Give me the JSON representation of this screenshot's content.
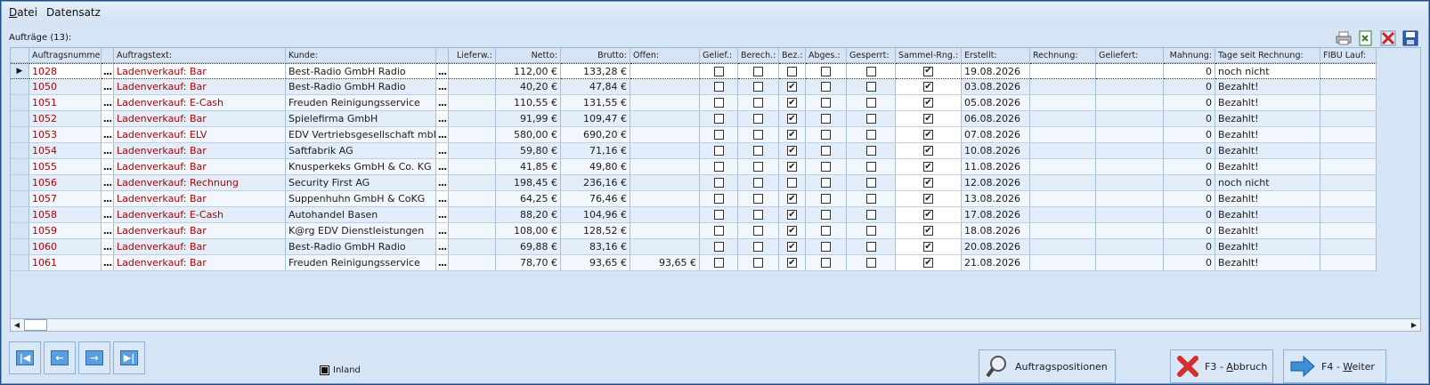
{
  "menu": {
    "datei": "Datei",
    "datei_rest": "atei",
    "datensatz": "Datensatz"
  },
  "grid": {
    "title": "Aufträge (13):",
    "columns": [
      "Auftragsnummer:",
      "",
      "Auftragstext:",
      "Kunde:",
      "",
      "Lieferw.:",
      "Netto:",
      "Brutto:",
      "Offen:",
      "Gelief.:",
      "Berech.:",
      "Bez.:",
      "Abges.:",
      "Gesperrt:",
      "Sammel-Rng.:",
      "Erstellt:",
      "Rechnung:",
      "Geliefert:",
      "Mahnung:",
      "Tage seit Rechnung:",
      "FIBU Lauf:"
    ],
    "rows": [
      {
        "nr": "1028",
        "text": "Ladenverkauf: Bar",
        "kunde": "Best-Radio GmbH Radio",
        "netto": "112,00 €",
        "brutto": "133,28 €",
        "offen": "",
        "bez": false,
        "sammel": true,
        "erstellt": "19.08.2026",
        "mahnung": "0",
        "tage": "noch nicht"
      },
      {
        "nr": "1050",
        "text": "Ladenverkauf: Bar",
        "kunde": "Best-Radio GmbH Radio",
        "netto": "40,20 €",
        "brutto": "47,84 €",
        "offen": "",
        "bez": true,
        "sammel": true,
        "erstellt": "03.08.2026",
        "mahnung": "0",
        "tage": "Bezahlt!"
      },
      {
        "nr": "1051",
        "text": "Ladenverkauf: E-Cash",
        "kunde": "Freuden Reinigungsservice",
        "netto": "110,55 €",
        "brutto": "131,55 €",
        "offen": "",
        "bez": true,
        "sammel": true,
        "erstellt": "05.08.2026",
        "mahnung": "0",
        "tage": "Bezahlt!"
      },
      {
        "nr": "1052",
        "text": "Ladenverkauf: Bar",
        "kunde": "Spielefirma GmbH",
        "netto": "91,99 €",
        "brutto": "109,47 €",
        "offen": "",
        "bez": true,
        "sammel": true,
        "erstellt": "06.08.2026",
        "mahnung": "0",
        "tage": "Bezahlt!"
      },
      {
        "nr": "1053",
        "text": "Ladenverkauf: ELV",
        "kunde": "EDV Vertriebsgesellschaft mbH",
        "netto": "580,00 €",
        "brutto": "690,20 €",
        "offen": "",
        "bez": true,
        "sammel": true,
        "erstellt": "07.08.2026",
        "mahnung": "0",
        "tage": "Bezahlt!"
      },
      {
        "nr": "1054",
        "text": "Ladenverkauf: Bar",
        "kunde": "Saftfabrik AG",
        "netto": "59,80 €",
        "brutto": "71,16 €",
        "offen": "",
        "bez": true,
        "sammel": true,
        "erstellt": "10.08.2026",
        "mahnung": "0",
        "tage": "Bezahlt!"
      },
      {
        "nr": "1055",
        "text": "Ladenverkauf: Bar",
        "kunde": "Knusperkeks GmbH & Co. KG",
        "netto": "41,85 €",
        "brutto": "49,80 €",
        "offen": "",
        "bez": true,
        "sammel": true,
        "erstellt": "11.08.2026",
        "mahnung": "0",
        "tage": "Bezahlt!"
      },
      {
        "nr": "1056",
        "text": "Ladenverkauf: Rechnung",
        "kunde": "Security First AG",
        "netto": "198,45 €",
        "brutto": "236,16 €",
        "offen": "",
        "bez": false,
        "sammel": true,
        "erstellt": "12.08.2026",
        "mahnung": "0",
        "tage": "noch nicht"
      },
      {
        "nr": "1057",
        "text": "Ladenverkauf: Bar",
        "kunde": "Suppenhuhn GmbH & CoKG",
        "netto": "64,25 €",
        "brutto": "76,46 €",
        "offen": "",
        "bez": true,
        "sammel": true,
        "erstellt": "13.08.2026",
        "mahnung": "0",
        "tage": "Bezahlt!"
      },
      {
        "nr": "1058",
        "text": "Ladenverkauf: E-Cash",
        "kunde": "Autohandel Basen",
        "netto": "88,20 €",
        "brutto": "104,96 €",
        "offen": "",
        "bez": true,
        "sammel": true,
        "erstellt": "17.08.2026",
        "mahnung": "0",
        "tage": "Bezahlt!"
      },
      {
        "nr": "1059",
        "text": "Ladenverkauf: Bar",
        "kunde": "K@rg EDV Dienstleistungen",
        "netto": "108,00 €",
        "brutto": "128,52 €",
        "offen": "",
        "bez": true,
        "sammel": true,
        "erstellt": "18.08.2026",
        "mahnung": "0",
        "tage": "Bezahlt!"
      },
      {
        "nr": "1060",
        "text": "Ladenverkauf: Bar",
        "kunde": "Best-Radio GmbH Radio",
        "netto": "69,88 €",
        "brutto": "83,16 €",
        "offen": "",
        "bez": true,
        "sammel": true,
        "erstellt": "20.08.2026",
        "mahnung": "0",
        "tage": "Bezahlt!"
      },
      {
        "nr": "1061",
        "text": "Ladenverkauf: Bar",
        "kunde": "Freuden Reinigungsservice",
        "netto": "78,70 €",
        "brutto": "93,65 €",
        "offen": "93,65 €",
        "bez": true,
        "sammel": true,
        "erstellt": "21.08.2026",
        "mahnung": "0",
        "tage": "Bezahlt!"
      }
    ],
    "ellipsis": "..."
  },
  "footer": {
    "inland": "Inland",
    "auftragspositionen": "Auftragspositionen",
    "abbruch_pre": "F3 - ",
    "abbruch_u": "A",
    "abbruch_post": "bbruch",
    "weiter_pre": "F4 - ",
    "weiter_u": "W",
    "weiter_post": "eiter"
  },
  "icons": {
    "first": "first-record-icon",
    "prev": "previous-record-icon",
    "next": "next-record-icon",
    "last": "last-record-icon"
  },
  "colors": {
    "accent_red": "#b00000",
    "window_bg": "#d6e5f6"
  }
}
